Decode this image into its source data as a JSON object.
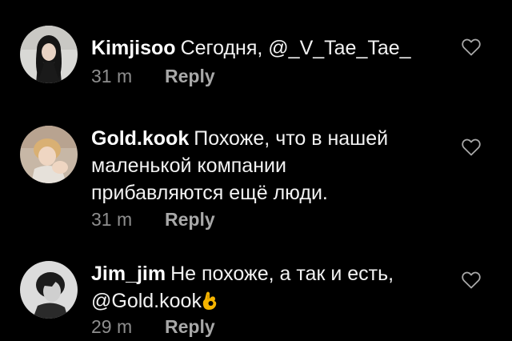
{
  "comments": [
    {
      "username": "Kimjisoo",
      "text": "Сегодня, @_V_Tae_Tae_",
      "time": "31 m",
      "reply_label": "Reply",
      "avatar_icon": "avatar-dark-hair-woman"
    },
    {
      "username": "Gold.kook",
      "text": "Похоже, что в нашей маленькой компании прибавляются ещё люди.",
      "time": "31 m",
      "reply_label": "Reply",
      "avatar_icon": "avatar-blond-man"
    },
    {
      "username": "Jim_jim",
      "text": "Не похоже, а так и есть, @Gold.kook",
      "time": "29 m",
      "reply_label": "Reply",
      "avatar_icon": "avatar-dark-hair-man",
      "trailing_emoji": "ok-hand-emoji"
    }
  ],
  "colors": {
    "background": "#000000",
    "text": "#f2f2f2",
    "meta": "#8e8e8e",
    "emoji": "#f5b400"
  },
  "like_icon": "heart-outline-icon"
}
